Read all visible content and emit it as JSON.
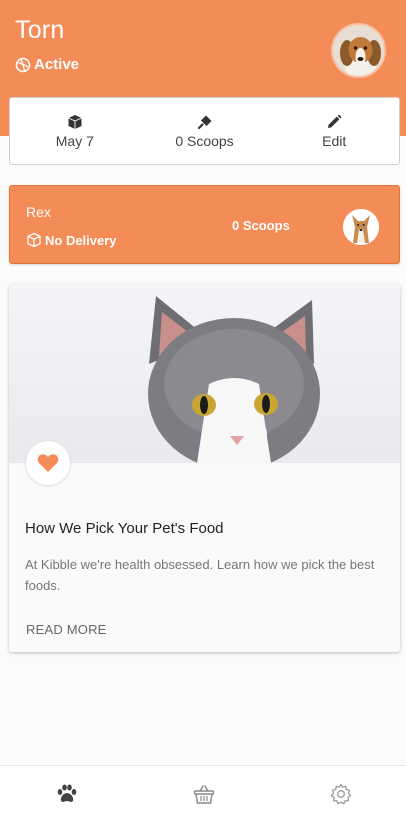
{
  "header": {
    "title": "Torn",
    "status": "Active"
  },
  "summary": {
    "date_label": "May 7",
    "scoops_label": "0 Scoops",
    "edit_label": "Edit"
  },
  "pet": {
    "name": "Rex",
    "delivery": "No Delivery",
    "scoops": "0 Scoops"
  },
  "article": {
    "title": "How We Pick Your Pet's Food",
    "body": "At Kibble we're health obsessed. Learn how we pick the best foods.",
    "read_more": "READ MORE"
  },
  "nav": {
    "items": [
      "paw-icon",
      "basket-icon",
      "gear-icon"
    ]
  },
  "colors": {
    "accent": "#f48c57",
    "background": "#fbfbfb",
    "text": "#333333"
  }
}
